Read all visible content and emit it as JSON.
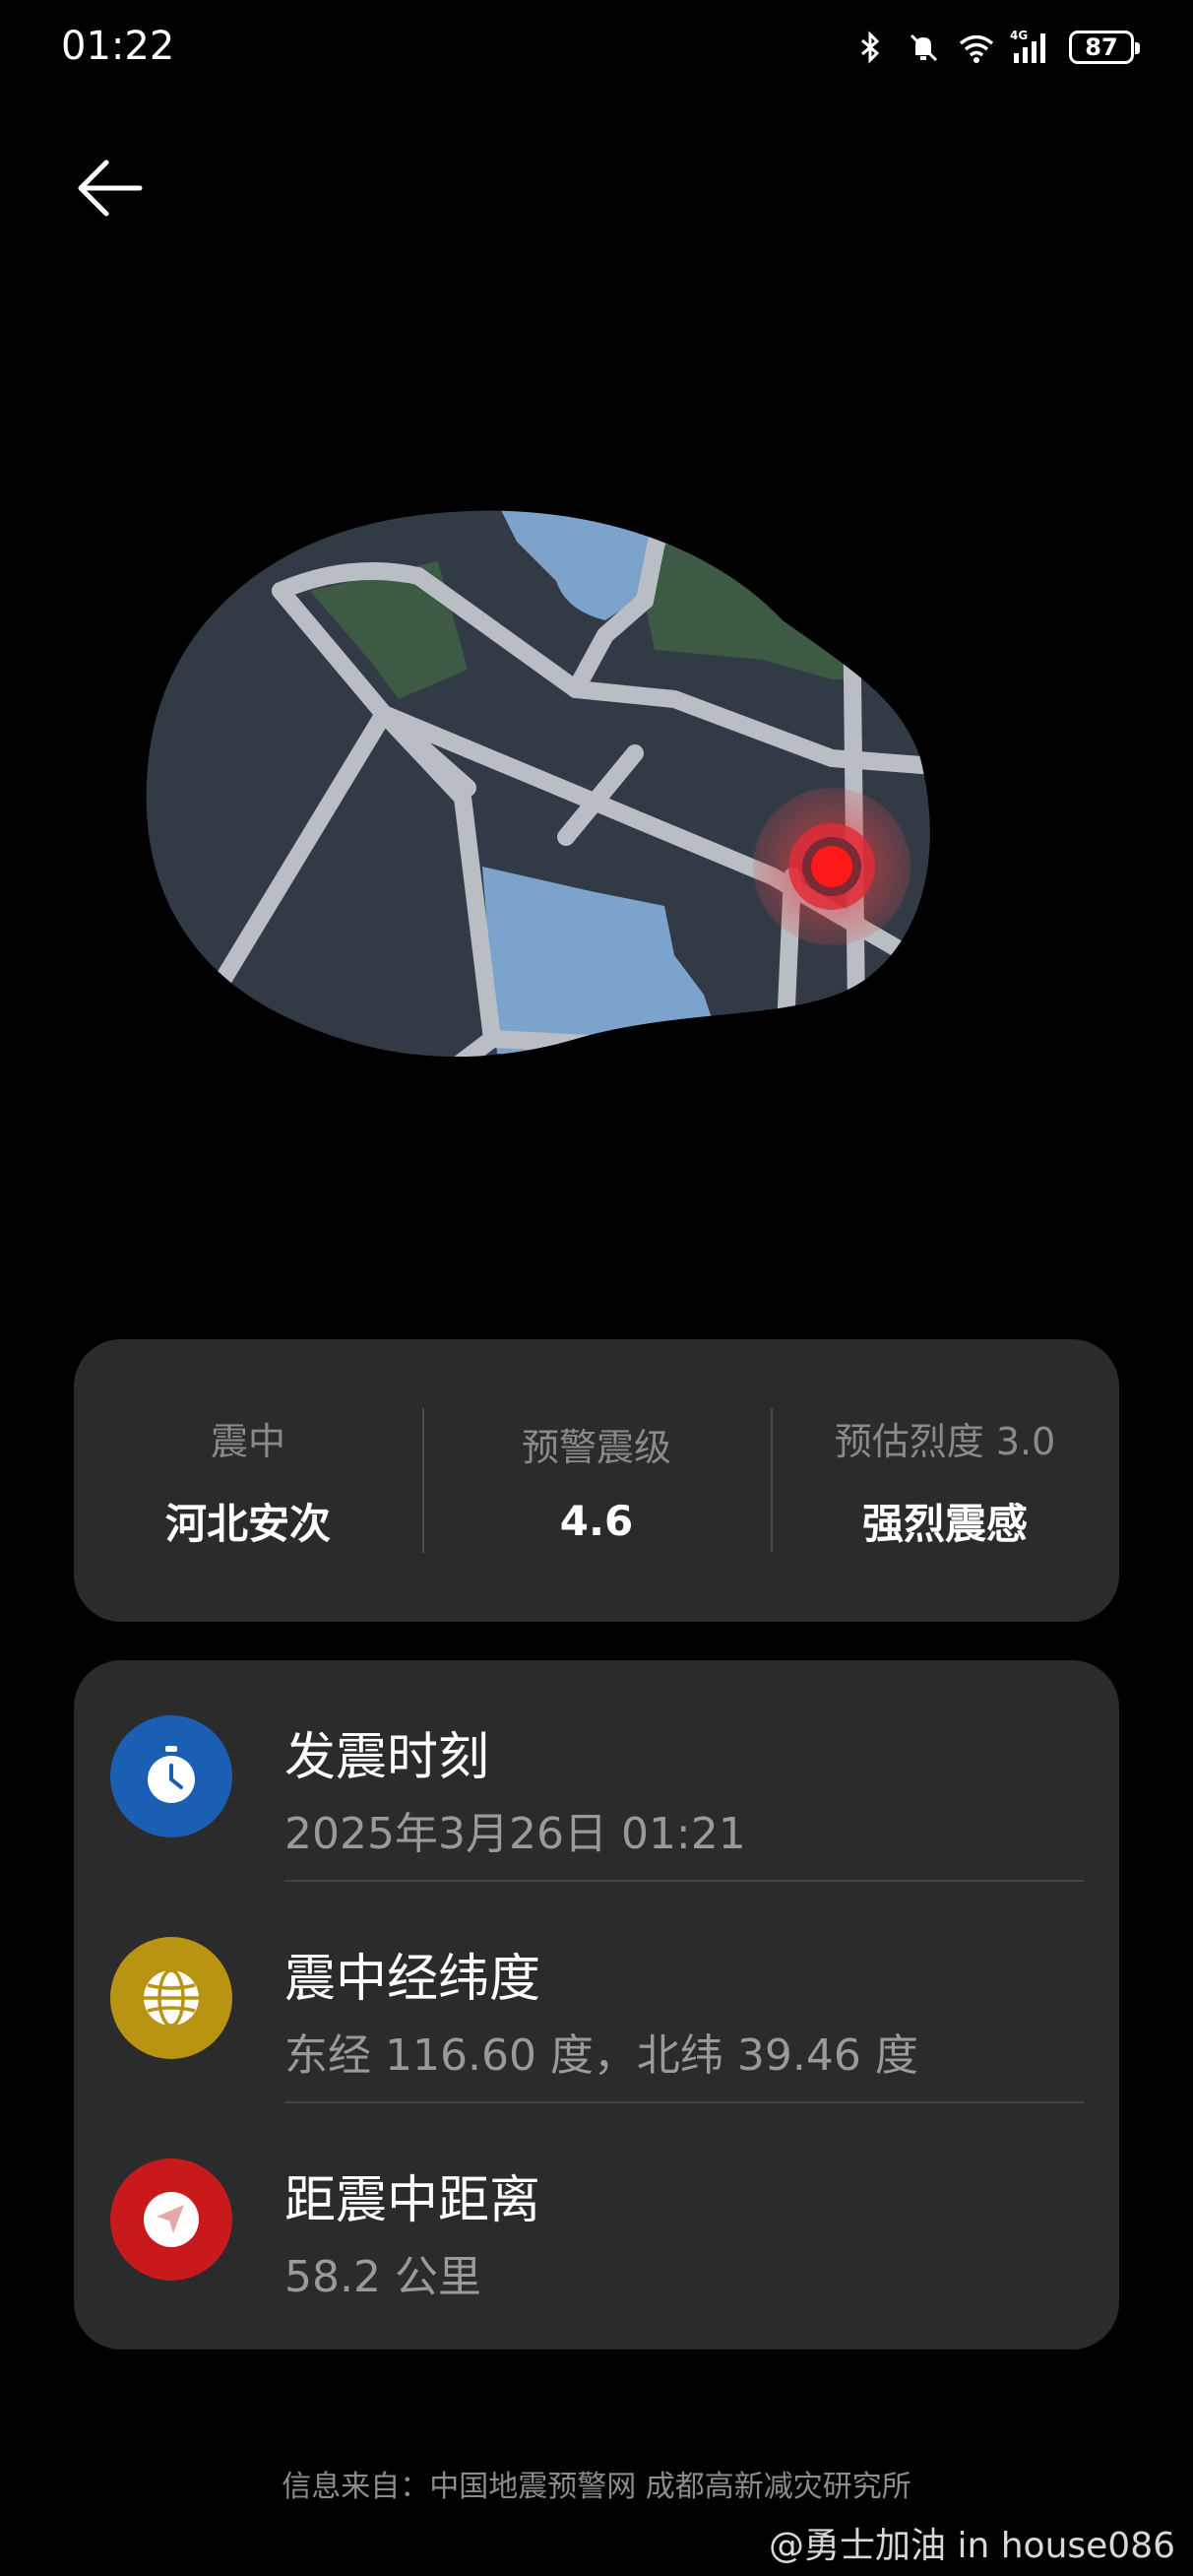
{
  "status_bar": {
    "time": "01:22",
    "battery": "87",
    "icons": [
      "bluetooth-icon",
      "mute-icon",
      "wifi-icon",
      "signal-4g-icon",
      "battery-icon"
    ]
  },
  "map": {
    "epicenter_color": "#ff1a1a",
    "land_color": "#323a46",
    "water_color": "#7ba3cc",
    "park_color": "#3d5a44",
    "road_color": "#b9bdc4"
  },
  "summary": {
    "epicenter_label": "震中",
    "epicenter_value": "河北安次",
    "magnitude_label": "预警震级",
    "magnitude_value": "4.6",
    "intensity_label": "预估烈度 3.0",
    "intensity_value": "强烈震感"
  },
  "details": [
    {
      "title": "发震时刻",
      "value": "2025年3月26日 01:21",
      "icon": "clock-icon",
      "color": "#1a5fb4"
    },
    {
      "title": "震中经纬度",
      "value": "东经 116.60 度，北纬 39.46 度",
      "icon": "globe-icon",
      "color": "#b89412"
    },
    {
      "title": "距震中距离",
      "value": "58.2 公里",
      "icon": "navigation-icon",
      "color": "#c81a1a"
    }
  ],
  "footer": "信息来自：中国地震预警网 成都高新减灾研究所",
  "watermark": "@勇士加油 in house086"
}
